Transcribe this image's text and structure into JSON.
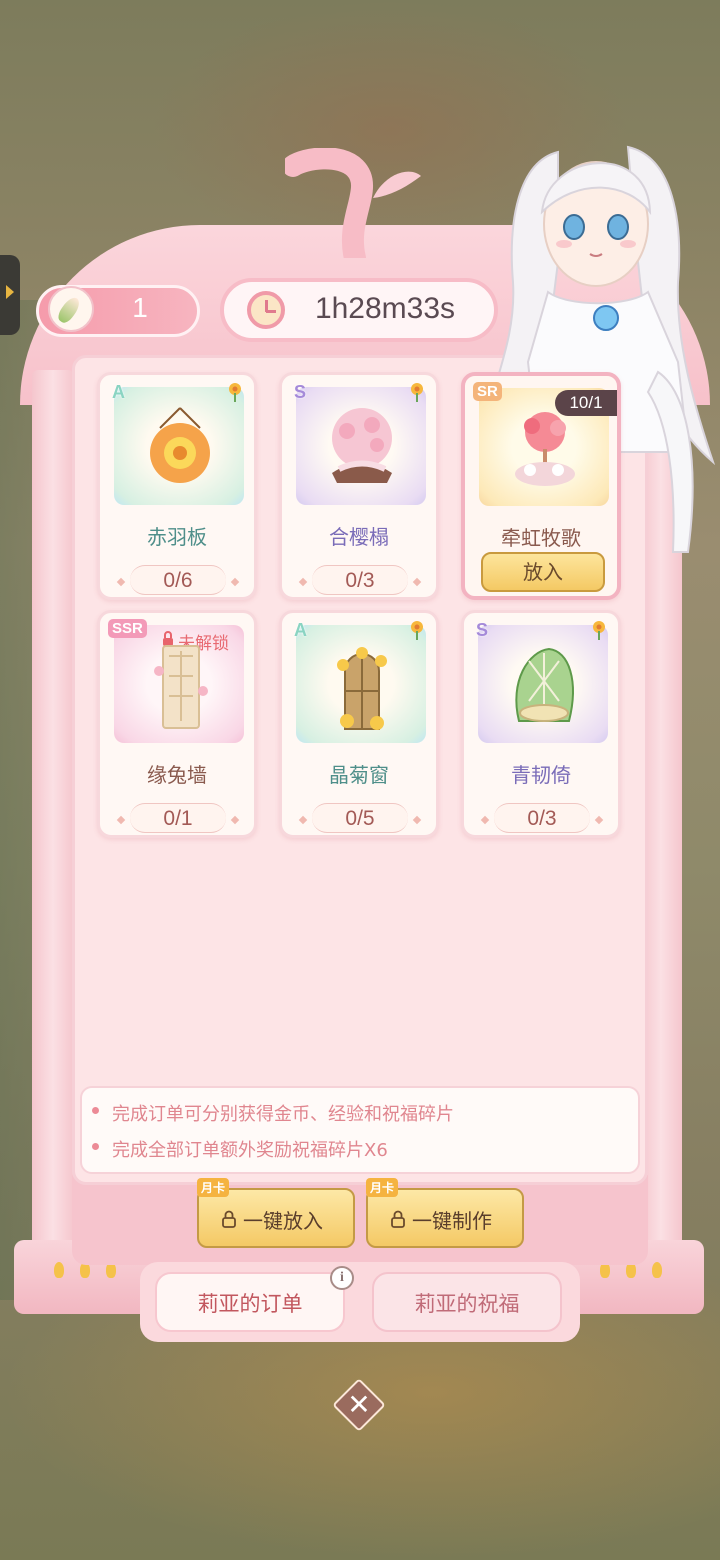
{
  "header": {
    "feather_count": "1",
    "timer": "1h28m33s"
  },
  "orders": [
    {
      "name": "赤羽板",
      "rarity": "A",
      "qty": "0/6",
      "name_color": "#4f8f8a",
      "locked": false
    },
    {
      "name": "合樱榻",
      "rarity": "S",
      "qty": "0/3",
      "name_color": "#7a6cb8",
      "locked": false
    },
    {
      "name": "牵虹牧歌",
      "rarity": "SR",
      "qty": "",
      "stock": "10/1",
      "button": "放入",
      "name_color": "#8a5a4e",
      "locked": false
    },
    {
      "name": "缘兔墙",
      "rarity": "SSR",
      "qty": "0/1",
      "lock_text": "未解锁",
      "name_color": "#8a5a4e",
      "locked": true
    },
    {
      "name": "晶菊窗",
      "rarity": "A",
      "qty": "0/5",
      "name_color": "#4f8f8a",
      "locked": false
    },
    {
      "name": "青韧倚",
      "rarity": "S",
      "qty": "0/3",
      "name_color": "#7a6cb8",
      "locked": false
    }
  ],
  "info": {
    "line1": "完成订单可分别获得金币、经验和祝福碎片",
    "line2": "完成全部订单额外奖励祝福碎片X6"
  },
  "actions": {
    "month_tag": "月卡",
    "quick_put": "一键放入",
    "quick_make": "一键制作"
  },
  "tabs": {
    "orders": "莉亚的订单",
    "blessing": "莉亚的祝福",
    "info_symbol": "i"
  },
  "close_symbol": "✕",
  "colors": {
    "frame_pink": "#f7c1ca",
    "panel_bg": "#fde4e6",
    "button_gold": "#f4c965"
  }
}
